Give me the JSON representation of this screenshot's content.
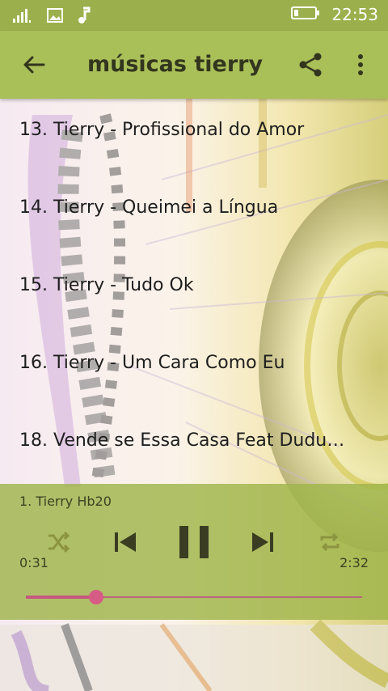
{
  "status_bar": {
    "time": "22:53"
  },
  "app_bar": {
    "title": "músicas tierry"
  },
  "songs": [
    {
      "label": "13. Tierry - Profissional do Amor"
    },
    {
      "label": "14. Tierry - Queimei a Língua"
    },
    {
      "label": "15. Tierry - Tudo Ok"
    },
    {
      "label": "16. Tierry - Um Cara Como Eu"
    },
    {
      "label": "18. Vende se Essa Casa Feat Dudu…"
    }
  ],
  "player": {
    "now_playing": "1. Tierry Hb20",
    "elapsed": "0:31",
    "duration": "2:32",
    "progress_fraction": 0.21
  },
  "colors": {
    "status_bar": "#9bb04c",
    "app_bar": "#a9bf58",
    "player_panel": "#9fb54a",
    "seek_accent": "#d65c86"
  },
  "icons": [
    "signal-icon",
    "image-icon",
    "music-note-icon",
    "battery-icon",
    "back-arrow-icon",
    "share-icon",
    "more-vert-icon",
    "shuffle-icon",
    "previous-icon",
    "pause-icon",
    "next-icon",
    "repeat-icon"
  ]
}
